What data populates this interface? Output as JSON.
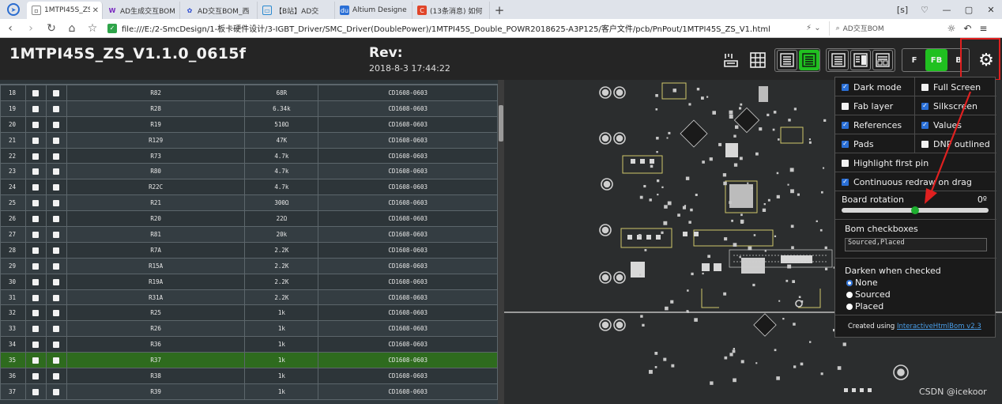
{
  "browser": {
    "tabs": [
      {
        "label": "1MTPI45S_ZS_V",
        "icon": "page-icon",
        "active": true
      },
      {
        "label": "AD生成交互BOM",
        "icon": "w-icon",
        "active": false
      },
      {
        "label": "AD交互BOM_西",
        "icon": "paw-icon",
        "active": false
      },
      {
        "label": "【B站】AD交",
        "icon": "tv-icon",
        "active": false
      },
      {
        "label": "Altium Designe",
        "icon": "du-icon",
        "active": false
      },
      {
        "label": "(13条消息) 如何",
        "icon": "c-icon",
        "active": false
      }
    ],
    "url": "file:///E:/2-SmcDesign/1-板卡硬件设计/3-IGBT_Driver/SMC_Driver(DoublePower)/1MTPI45S_Double_POWR2018625-A3P125/客户文件/pcb/PnPout/1MTPI45S_ZS_V1.html",
    "search_text": "AD交互BOM"
  },
  "header": {
    "title": "1MTPI45S_ZS_V1.1.0_0615f",
    "rev_label": "Rev:",
    "rev_date": "2018-8-3 17:44:22",
    "layer_buttons": [
      "F",
      "FB",
      "B"
    ]
  },
  "bom_rows": [
    {
      "num": "18",
      "ref": "R82",
      "value": "68R",
      "footprint": "CD1608-0603"
    },
    {
      "num": "19",
      "ref": "R28",
      "value": "6.34k",
      "footprint": "CD1608-0603"
    },
    {
      "num": "20",
      "ref": "R19",
      "value": "510Ω",
      "footprint": "CD1608-0603"
    },
    {
      "num": "21",
      "ref": "R129",
      "value": "47K",
      "footprint": "CD1608-0603"
    },
    {
      "num": "22",
      "ref": "R73",
      "value": "4.7k",
      "footprint": "CD1608-0603"
    },
    {
      "num": "23",
      "ref": "R80",
      "value": "4.7k",
      "footprint": "CD1608-0603"
    },
    {
      "num": "24",
      "ref": "R22C",
      "value": "4.7k",
      "footprint": "CD1608-0603"
    },
    {
      "num": "25",
      "ref": "R21",
      "value": "300Ω",
      "footprint": "CD1608-0603"
    },
    {
      "num": "26",
      "ref": "R20",
      "value": "22Ω",
      "footprint": "CD1608-0603"
    },
    {
      "num": "27",
      "ref": "R81",
      "value": "20k",
      "footprint": "CD1608-0603"
    },
    {
      "num": "28",
      "ref": "R7A",
      "value": "2.2K",
      "footprint": "CD1608-0603"
    },
    {
      "num": "29",
      "ref": "R15A",
      "value": "2.2K",
      "footprint": "CD1608-0603"
    },
    {
      "num": "30",
      "ref": "R19A",
      "value": "2.2K",
      "footprint": "CD1608-0603"
    },
    {
      "num": "31",
      "ref": "R31A",
      "value": "2.2K",
      "footprint": "CD1608-0603"
    },
    {
      "num": "32",
      "ref": "R25",
      "value": "1k",
      "footprint": "CD1608-0603"
    },
    {
      "num": "33",
      "ref": "R26",
      "value": "1k",
      "footprint": "CD1608-0603"
    },
    {
      "num": "34",
      "ref": "R36",
      "value": "1k",
      "footprint": "CD1608-0603"
    },
    {
      "num": "35",
      "ref": "R37",
      "value": "1k",
      "footprint": "CD1608-0603",
      "highlighted": true
    },
    {
      "num": "36",
      "ref": "R38",
      "value": "1k",
      "footprint": "CD1608-0603"
    },
    {
      "num": "37",
      "ref": "R39",
      "value": "1k",
      "footprint": "CD1608-0603"
    }
  ],
  "settings": {
    "dark_mode": {
      "label": "Dark mode",
      "checked": true
    },
    "full_screen": {
      "label": "Full Screen",
      "checked": false
    },
    "fab_layer": {
      "label": "Fab layer",
      "checked": false
    },
    "silkscreen": {
      "label": "Silkscreen",
      "checked": true
    },
    "references": {
      "label": "References",
      "checked": true
    },
    "values": {
      "label": "Values",
      "checked": true
    },
    "pads": {
      "label": "Pads",
      "checked": true
    },
    "dnp_outlined": {
      "label": "DNP outlined",
      "checked": false
    },
    "highlight_first_pin": {
      "label": "Highlight first pin",
      "checked": false
    },
    "continuous_redraw": {
      "label": "Continuous redraw on drag",
      "checked": true
    },
    "board_rotation_label": "Board rotation",
    "board_rotation_value": "0º",
    "board_rotation_fraction": 0.5,
    "bom_checkboxes_label": "Bom checkboxes",
    "bom_checkboxes_value": "Sourced,Placed",
    "darken_label": "Darken when checked",
    "darken_options": [
      "None",
      "Sourced",
      "Placed"
    ],
    "darken_selected": "None",
    "credit_prefix": "Created using ",
    "credit_link": "InteractiveHtmlBom v2.3"
  },
  "watermark": "CSDN @icekoor",
  "colors": {
    "accent_green": "#20c020",
    "checkbox_blue": "#2a6fd6",
    "highlight_row": "#2e6b1e",
    "annotation_red": "#e02020"
  }
}
